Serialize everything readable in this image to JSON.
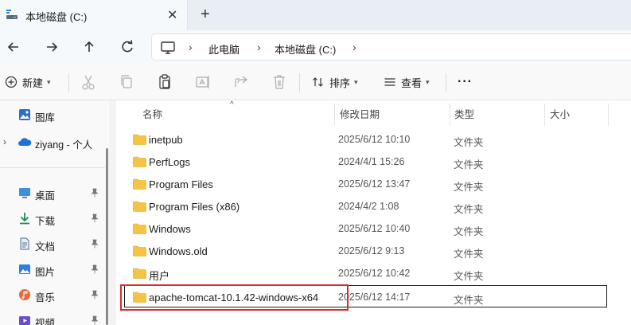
{
  "window": {
    "tab_title": "本地磁盘 (C:)",
    "tab_close": "✕",
    "tab_add": "+"
  },
  "address": {
    "segments": [
      "此电脑",
      "本地磁盘 (C:)"
    ],
    "chevron": "›"
  },
  "toolbar": {
    "new_label": "新建",
    "sort_label": "排序",
    "view_label": "查看",
    "more_label": "···"
  },
  "sidebar": {
    "items": [
      {
        "label": "图库",
        "icon": "gallery-icon",
        "pinned": false
      },
      {
        "label": "ziyang - 个人",
        "icon": "cloud-icon",
        "pinned": false
      },
      {
        "label": "桌面",
        "icon": "desktop-icon",
        "pinned": true
      },
      {
        "label": "下载",
        "icon": "download-icon",
        "pinned": true
      },
      {
        "label": "文档",
        "icon": "document-icon",
        "pinned": true
      },
      {
        "label": "图片",
        "icon": "picture-icon",
        "pinned": true
      },
      {
        "label": "音乐",
        "icon": "music-icon",
        "pinned": true
      },
      {
        "label": "视频",
        "icon": "video-icon",
        "pinned": true
      }
    ]
  },
  "columns": {
    "name": "名称",
    "modified": "修改日期",
    "type": "类型",
    "size": "大小"
  },
  "files": [
    {
      "name": "inetpub",
      "modified": "2025/6/12 10:10",
      "type": "文件夹"
    },
    {
      "name": "PerfLogs",
      "modified": "2024/4/1 15:26",
      "type": "文件夹"
    },
    {
      "name": "Program Files",
      "modified": "2025/6/12 13:47",
      "type": "文件夹"
    },
    {
      "name": "Program Files (x86)",
      "modified": "2024/4/2 1:08",
      "type": "文件夹"
    },
    {
      "name": "Windows",
      "modified": "2025/6/12 10:40",
      "type": "文件夹"
    },
    {
      "name": "Windows.old",
      "modified": "2025/6/12 9:13",
      "type": "文件夹"
    },
    {
      "name": "用户",
      "modified": "2025/6/12 10:42",
      "type": "文件夹"
    },
    {
      "name": "apache-tomcat-10.1.42-windows-x64",
      "modified": "2025/6/12 14:17",
      "type": "文件夹"
    }
  ],
  "colors": {
    "folder": "#f5c443",
    "accent": "#0067c0",
    "highlight": "#d92b2b"
  }
}
